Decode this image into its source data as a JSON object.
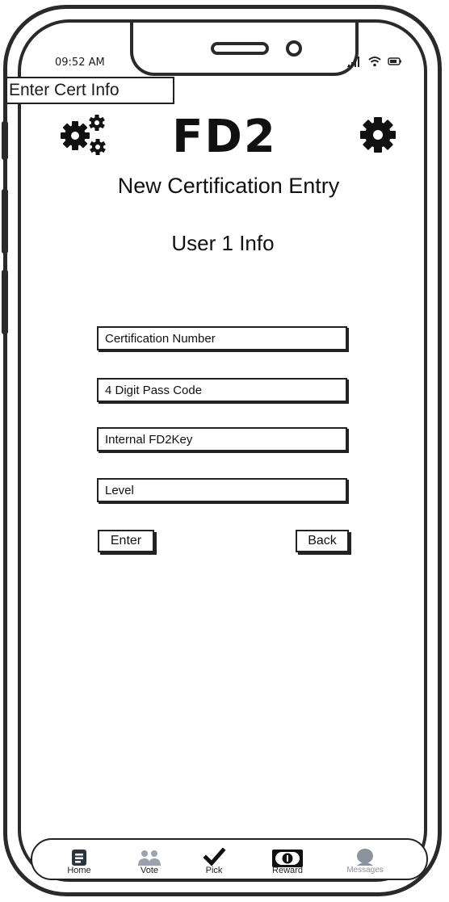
{
  "status_bar": {
    "time": "09:52 AM",
    "icons": [
      "signal-icon",
      "wifi-icon",
      "battery-icon"
    ]
  },
  "screen_label": "Enter Cert Info",
  "header": {
    "logo": "FD2",
    "left_icon": "gears-icon",
    "right_icon": "gear-icon"
  },
  "title": "New Certification Entry",
  "subtitle": "User 1 Info",
  "form": {
    "certification_number": {
      "placeholder": "Certification Number",
      "value": ""
    },
    "pass_code": {
      "placeholder": "4 Digit Pass Code",
      "value": ""
    },
    "internal_key": {
      "placeholder": "Internal FD2Key",
      "value": ""
    },
    "level": {
      "placeholder": "Level",
      "value": ""
    },
    "enter_label": "Enter",
    "back_label": "Back"
  },
  "tabbar": {
    "items": [
      {
        "label": "Home",
        "icon": "home-icon",
        "active": false
      },
      {
        "label": "Vote",
        "icon": "users-icon",
        "active": false
      },
      {
        "label": "Pick",
        "icon": "checkmark-icon",
        "active": false
      },
      {
        "label": "Reward",
        "icon": "reward-icon",
        "active": false
      },
      {
        "label": "Messages",
        "icon": "message-icon",
        "active": false
      }
    ]
  },
  "colors": {
    "ink": "#222222",
    "muted": "#9aa3ad",
    "background": "#ffffff"
  }
}
